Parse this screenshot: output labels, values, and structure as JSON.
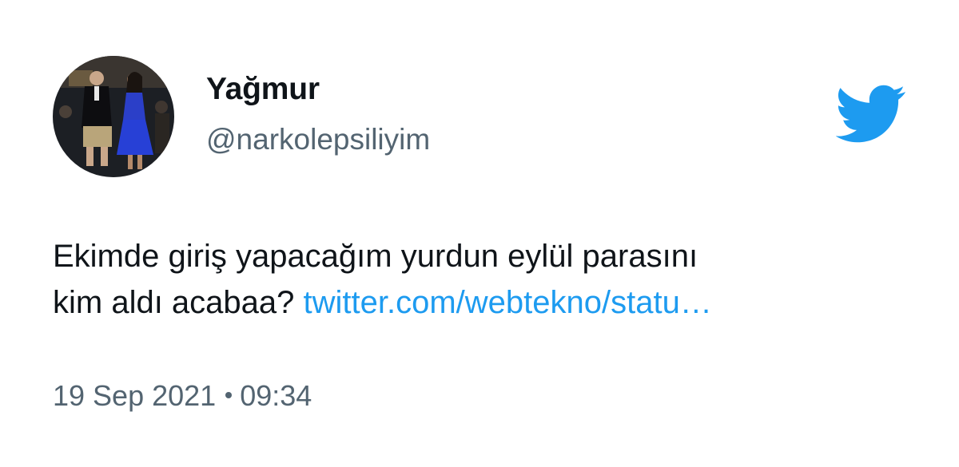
{
  "author": {
    "name": "Yağmur",
    "handle": "@narkolepsiliyim"
  },
  "tweet": {
    "text_line1": "Ekimde giriş yapacağım yurdun eylül parasını",
    "text_line2": "kim aldı acabaa?",
    "link": "twitter.com/webtekno/statu…"
  },
  "meta": {
    "date": "19 Sep 2021",
    "time": "09:34"
  },
  "icons": {
    "brand": "twitter-bird-icon",
    "avatar": "profile-photo"
  },
  "colors": {
    "link": "#1d9bf0",
    "brand": "#1d9bf0",
    "secondary_text": "#536471"
  }
}
